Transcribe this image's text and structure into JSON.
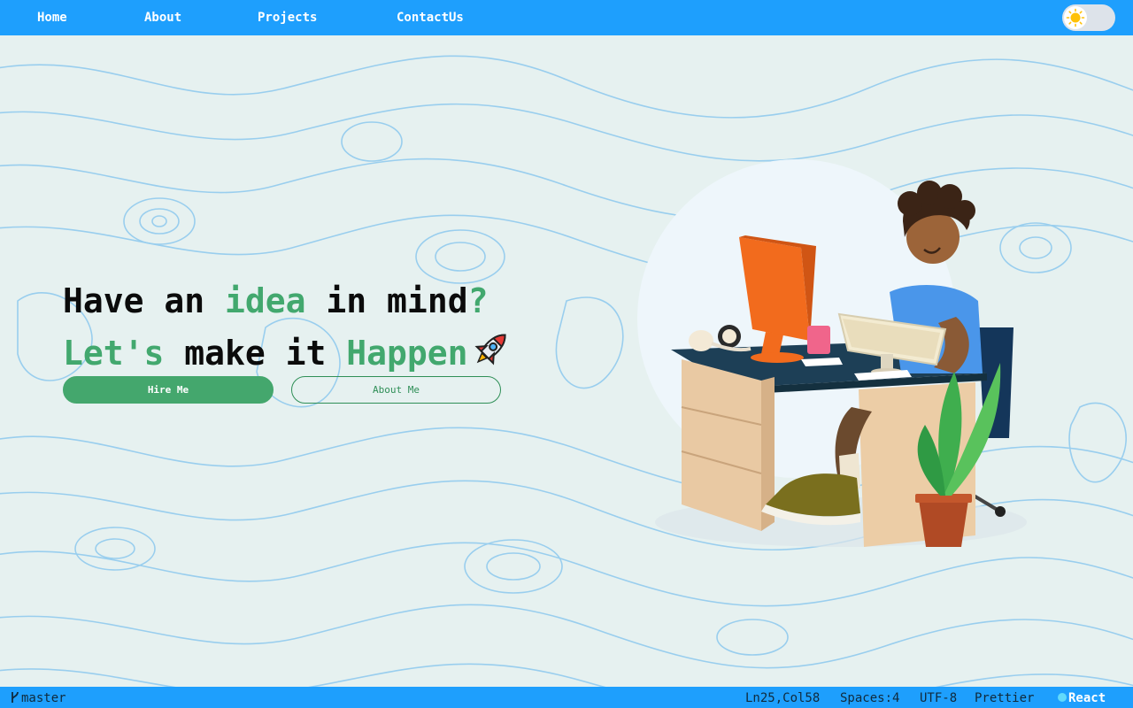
{
  "nav": {
    "links": [
      {
        "label": "Home"
      },
      {
        "label": "About"
      },
      {
        "label": "Projects"
      },
      {
        "label": "ContactUs"
      }
    ],
    "theme_toggle_icon": "sun-icon",
    "bar_color": "#1e9ffd"
  },
  "hero": {
    "line1": {
      "pre": "Have an ",
      "accent": "idea",
      "mid": " in mind",
      "accent2": "?"
    },
    "line2": {
      "accent": "Let's",
      "mid": " make it ",
      "accent2": "Happen"
    },
    "rocket_icon": "rocket-icon",
    "accent_color": "#42a86e",
    "buttons": {
      "primary": "Hire Me",
      "secondary": "About Me"
    }
  },
  "illustration": {
    "icon": "developer-at-desk-illustration"
  },
  "statusbar": {
    "branch_icon": "git-branch-icon",
    "branch": "master",
    "position": "Ln25,Col58",
    "spaces": "Spaces:4",
    "encoding": "UTF-8",
    "formatter": "Prettier",
    "language": "React",
    "language_icon": "react-icon"
  }
}
